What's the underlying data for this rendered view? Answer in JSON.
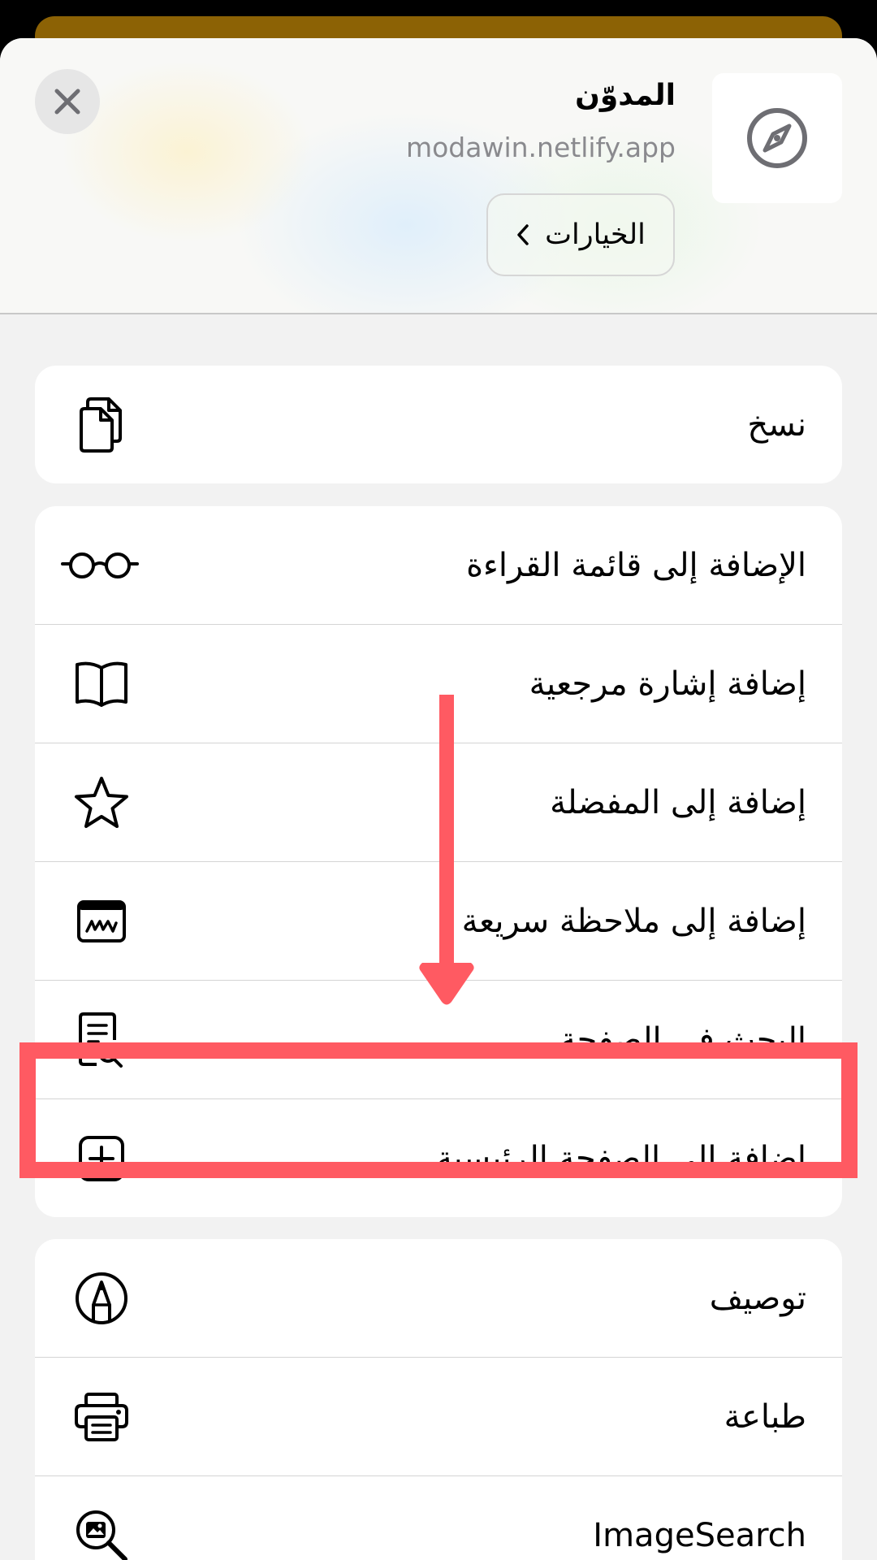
{
  "header": {
    "site_title": "المدوّن",
    "site_url": "modawin.netlify.app",
    "options_label": "الخيارات",
    "site_icon": "compass-icon",
    "close_icon": "close-icon"
  },
  "groups": [
    {
      "items": [
        {
          "label": "نسخ",
          "icon": "copy-icon"
        }
      ]
    },
    {
      "items": [
        {
          "label": "الإضافة إلى قائمة القراءة",
          "icon": "glasses-icon"
        },
        {
          "label": "إضافة إشارة مرجعية",
          "icon": "book-icon"
        },
        {
          "label": "إضافة إلى المفضلة",
          "icon": "star-icon"
        },
        {
          "label": "إضافة إلى ملاحظة سريعة",
          "icon": "quick-note-icon"
        },
        {
          "label": "البحث في الصفحة",
          "icon": "find-in-page-icon"
        },
        {
          "label": "إضافة إلى الصفحة الرئيسية",
          "icon": "add-square-icon"
        }
      ]
    },
    {
      "items": [
        {
          "label": "توصيف",
          "icon": "markup-pen-icon"
        },
        {
          "label": "طباعة",
          "icon": "printer-icon"
        },
        {
          "label": "ImageSearch",
          "icon": "image-search-icon"
        }
      ]
    }
  ],
  "annotation": {
    "highlight_color": "#ff5a62",
    "highlighted_item": "إضافة إلى الصفحة الرئيسية"
  }
}
